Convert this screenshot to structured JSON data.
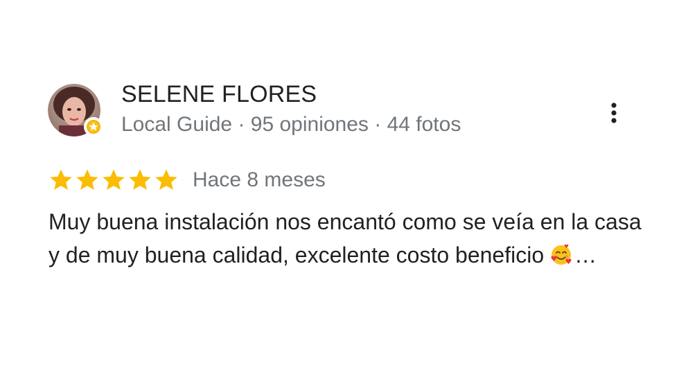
{
  "review": {
    "author": {
      "name": "SELENE FLORES",
      "meta": "Local Guide · 95 opiniones · 44 fotos",
      "avatar_icon": "profile-photo",
      "badge_icon": "local-guide-star-badge"
    },
    "rating": {
      "stars": 5,
      "max_stars": 5,
      "star_color": "#fbbc04"
    },
    "date": "Hace 8 meses",
    "text": "Muy buena instalación nos encantó como se veía en la casa y de muy buena calidad, excelente costo beneficio",
    "emoji_icon": "smiling-face-with-hearts",
    "ellipsis": "…",
    "menu_icon": "more-vert-icon"
  }
}
